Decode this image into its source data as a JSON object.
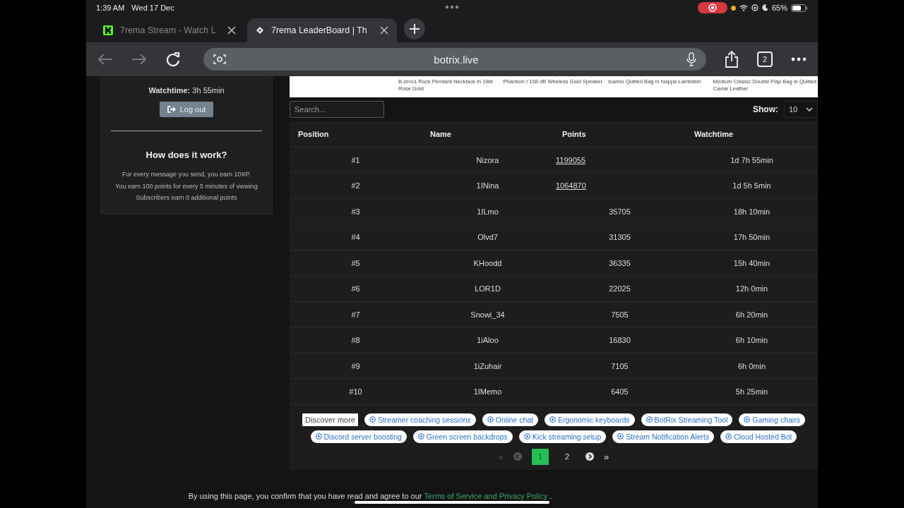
{
  "status_bar": {
    "time": "1:39 AM",
    "date": "Wed 17 Dec",
    "battery": "65%"
  },
  "tabs": [
    {
      "title": "7rema Stream - Watch L",
      "selected": false
    },
    {
      "title": "7rema LeaderBoard | Th",
      "selected": true
    }
  ],
  "address_bar": {
    "url": "botrix.live",
    "tab_count": "2"
  },
  "profile_card": {
    "watchtime_label": "Watchtime:",
    "watchtime": "3h 55min",
    "logout": "Log out",
    "heading": "How does it work?",
    "lines": [
      "For every message you send, you earn 10XP.",
      "You earn 100 points for every 5 minutes of viewing",
      "Subscribers earn 0 additional points"
    ]
  },
  "ad_strip": {
    "products": [
      "B.zero1 Rock Pendant Necklace in 18kt Rose Gold",
      "Phantom I 108 dB Wireless Gold Speaker",
      "Icarino Quilted Bag in Nappa Lambskin",
      "Medium Classic Double Flap Bag in Quilted Caviar Leather"
    ]
  },
  "search": {
    "placeholder": "Search..."
  },
  "show": {
    "label": "Show:",
    "value": "10"
  },
  "table": {
    "columns": [
      "Position",
      "Name",
      "Points",
      "Watchtime"
    ],
    "rows": [
      {
        "position": "#1",
        "name": "Nizora",
        "points": "1199055",
        "linked": true,
        "watchtime": "1d 7h 55min"
      },
      {
        "position": "#2",
        "name": "1INina",
        "points": "1064870",
        "linked": true,
        "watchtime": "1d 5h 5min"
      },
      {
        "position": "#3",
        "name": "1ILmo",
        "points": "35705",
        "linked": false,
        "watchtime": "18h 10min"
      },
      {
        "position": "#4",
        "name": "Olvd7",
        "points": "31305",
        "linked": false,
        "watchtime": "17h 50min"
      },
      {
        "position": "#5",
        "name": "KHoodd",
        "points": "36335",
        "linked": false,
        "watchtime": "15h 40min"
      },
      {
        "position": "#6",
        "name": "LOR1D",
        "points": "22025",
        "linked": false,
        "watchtime": "12h 0min"
      },
      {
        "position": "#7",
        "name": "Snowi_34",
        "points": "7505",
        "linked": false,
        "watchtime": "6h 20min"
      },
      {
        "position": "#8",
        "name": "1iAloo",
        "points": "16830",
        "linked": false,
        "watchtime": "6h 10min"
      },
      {
        "position": "#9",
        "name": "1iZuhair",
        "points": "7105",
        "linked": false,
        "watchtime": "6h 0min"
      },
      {
        "position": "#10",
        "name": "1IMemo",
        "points": "6405",
        "linked": false,
        "watchtime": "5h 25min"
      }
    ]
  },
  "discover": {
    "label": "Discover more",
    "chips": [
      "Streamer coaching sessions",
      "Online chat",
      "Ergonomic keyboards",
      "BotRix Streaming Tool",
      "Gaming chairs",
      "Discord server boosting",
      "Green screen backdrops",
      "Kick streaming setup",
      "Stream Notification Alerts",
      "Cloud Hosted Bot"
    ]
  },
  "pagination": {
    "first": "«",
    "last": "»",
    "pages": [
      {
        "label": "1",
        "selected": true
      },
      {
        "label": "2",
        "selected": false
      }
    ]
  },
  "footer": {
    "text": "By using this page, you confirm that you have read and agree to our",
    "link": "Terms of Service and Privacy Policy",
    "end": "."
  }
}
